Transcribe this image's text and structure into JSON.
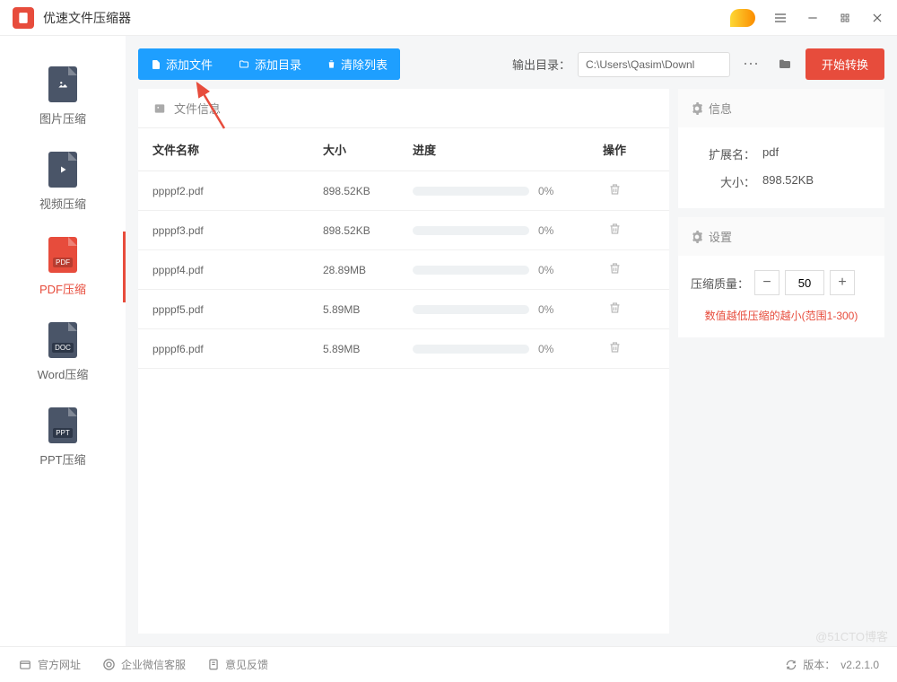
{
  "app": {
    "title": "优速文件压缩器"
  },
  "sidebar": {
    "items": [
      {
        "label": "图片压缩",
        "badge": ""
      },
      {
        "label": "视频压缩",
        "badge": ""
      },
      {
        "label": "PDF压缩",
        "badge": "PDF"
      },
      {
        "label": "Word压缩",
        "badge": "DOC"
      },
      {
        "label": "PPT压缩",
        "badge": "PPT"
      }
    ]
  },
  "toolbar": {
    "add_file": "添加文件",
    "add_dir": "添加目录",
    "clear": "清除列表",
    "out_label": "输出目录：",
    "out_path": "C:\\Users\\Qasim\\Downl",
    "start": "开始转换"
  },
  "panel": {
    "file_info": "文件信息",
    "info": "信息",
    "settings": "设置"
  },
  "table": {
    "headers": {
      "name": "文件名称",
      "size": "大小",
      "progress": "进度",
      "action": "操作"
    },
    "rows": [
      {
        "name": "ppppf2.pdf",
        "size": "898.52KB",
        "progress": "0%"
      },
      {
        "name": "ppppf3.pdf",
        "size": "898.52KB",
        "progress": "0%"
      },
      {
        "name": "ppppf4.pdf",
        "size": "28.89MB",
        "progress": "0%"
      },
      {
        "name": "ppppf5.pdf",
        "size": "5.89MB",
        "progress": "0%"
      },
      {
        "name": "ppppf6.pdf",
        "size": "5.89MB",
        "progress": "0%"
      }
    ]
  },
  "info": {
    "ext_label": "扩展名：",
    "ext_val": "pdf",
    "size_label": "大小：",
    "size_val": "898.52KB"
  },
  "settings": {
    "quality_label": "压缩质量：",
    "quality_val": "50",
    "hint": "数值越低压缩的越小(范围1-300)"
  },
  "footer": {
    "site": "官方网址",
    "wechat": "企业微信客服",
    "feedback": "意见反馈",
    "version_label": "版本：",
    "version": "v2.2.1.0"
  },
  "watermark": "@51CTO博客"
}
